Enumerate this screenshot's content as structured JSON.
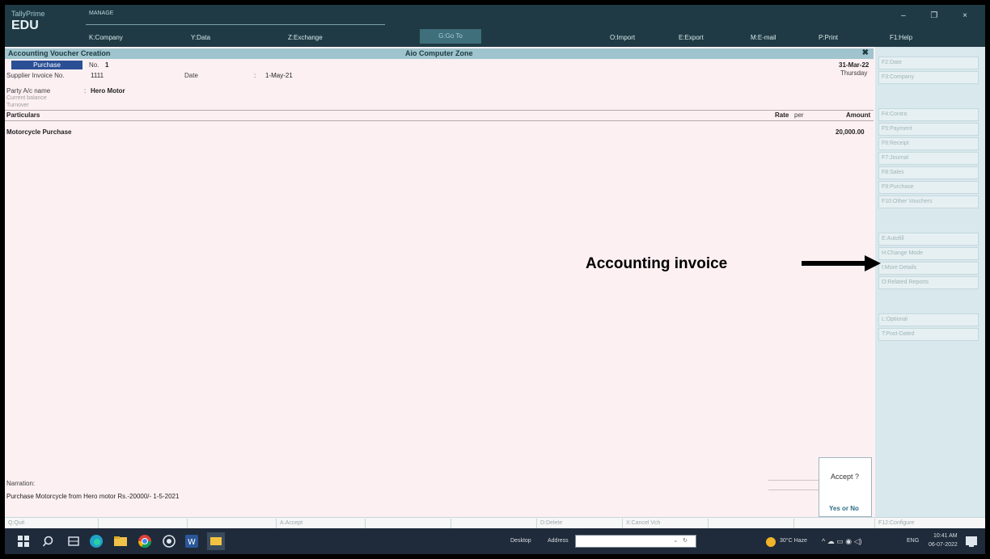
{
  "app": {
    "brand_small": "TallyPrime",
    "brand_large": "EDU",
    "company_tag": "MANAGE",
    "menu": {
      "company": "K:Company",
      "data": "Y:Data",
      "exchange": "Z:Exchange",
      "goto": "G:Go To",
      "import": "O:Import",
      "export": "E:Export",
      "email": "M:E-mail",
      "print": "P:Print",
      "help": "F1:Help"
    },
    "window_controls": "– ❐ ×"
  },
  "title_strip": {
    "left": "Accounting Voucher Creation",
    "center": "Aio Computer Zone",
    "close": "✖"
  },
  "voucher": {
    "type": "Purchase",
    "no_label": "No.",
    "no_value": "1",
    "date_right": "31-Mar-22",
    "day_right": "Thursday",
    "supplier_invoice_label": "Supplier Invoice No.",
    "supplier_invoice_value": "1111",
    "date_label": "Date",
    "date_sep": ":",
    "date_value": "1-May-21",
    "party_label": "Party A/c name",
    "party_sep": ":",
    "party_value": "Hero Motor",
    "current_balance_label": "Current balance",
    "turnover_label": "Turnover"
  },
  "particulars": {
    "header_particulars": "Particulars",
    "header_rate": "Rate",
    "header_per": "per",
    "header_amount": "Amount",
    "rows": [
      {
        "ledger": "Motorcycle Purchase",
        "amount": "20,000.00"
      }
    ]
  },
  "narration": {
    "label": "Narration:",
    "text": "Purchase Motorcycle from Hero motor Rs.-20000/- 1-5-2021"
  },
  "accept": {
    "question": "Accept ?",
    "yes": "Yes",
    "or": "or",
    "no": "No"
  },
  "bottom_buttons": {
    "quit": "Q:Quit",
    "accept": "A:Accept",
    "delete": "D:Delete",
    "cancel": "X:Cancel Vch",
    "configure": "F12:Configure"
  },
  "right_panel": {
    "group1": [
      "F2:Date",
      "F3:Company"
    ],
    "group2": [
      "F4:Contra",
      "F5:Payment",
      "F6:Receipt",
      "F7:Journal",
      "F8:Sales",
      "F9:Purchase",
      "F10:Other Vouchers"
    ],
    "group3": [
      "E:Autofill",
      "H:Change Mode",
      "I:More Details",
      "O:Related Reports"
    ],
    "group4": [
      "L:Optional",
      "T:Post-Dated"
    ]
  },
  "annotation": {
    "text": "Accounting invoice"
  },
  "taskbar": {
    "desktop": "Desktop",
    "address": "Address",
    "weather": "30°C Haze",
    "lang": "ENG",
    "time": "10:41 AM",
    "date": "06-07-2022"
  }
}
